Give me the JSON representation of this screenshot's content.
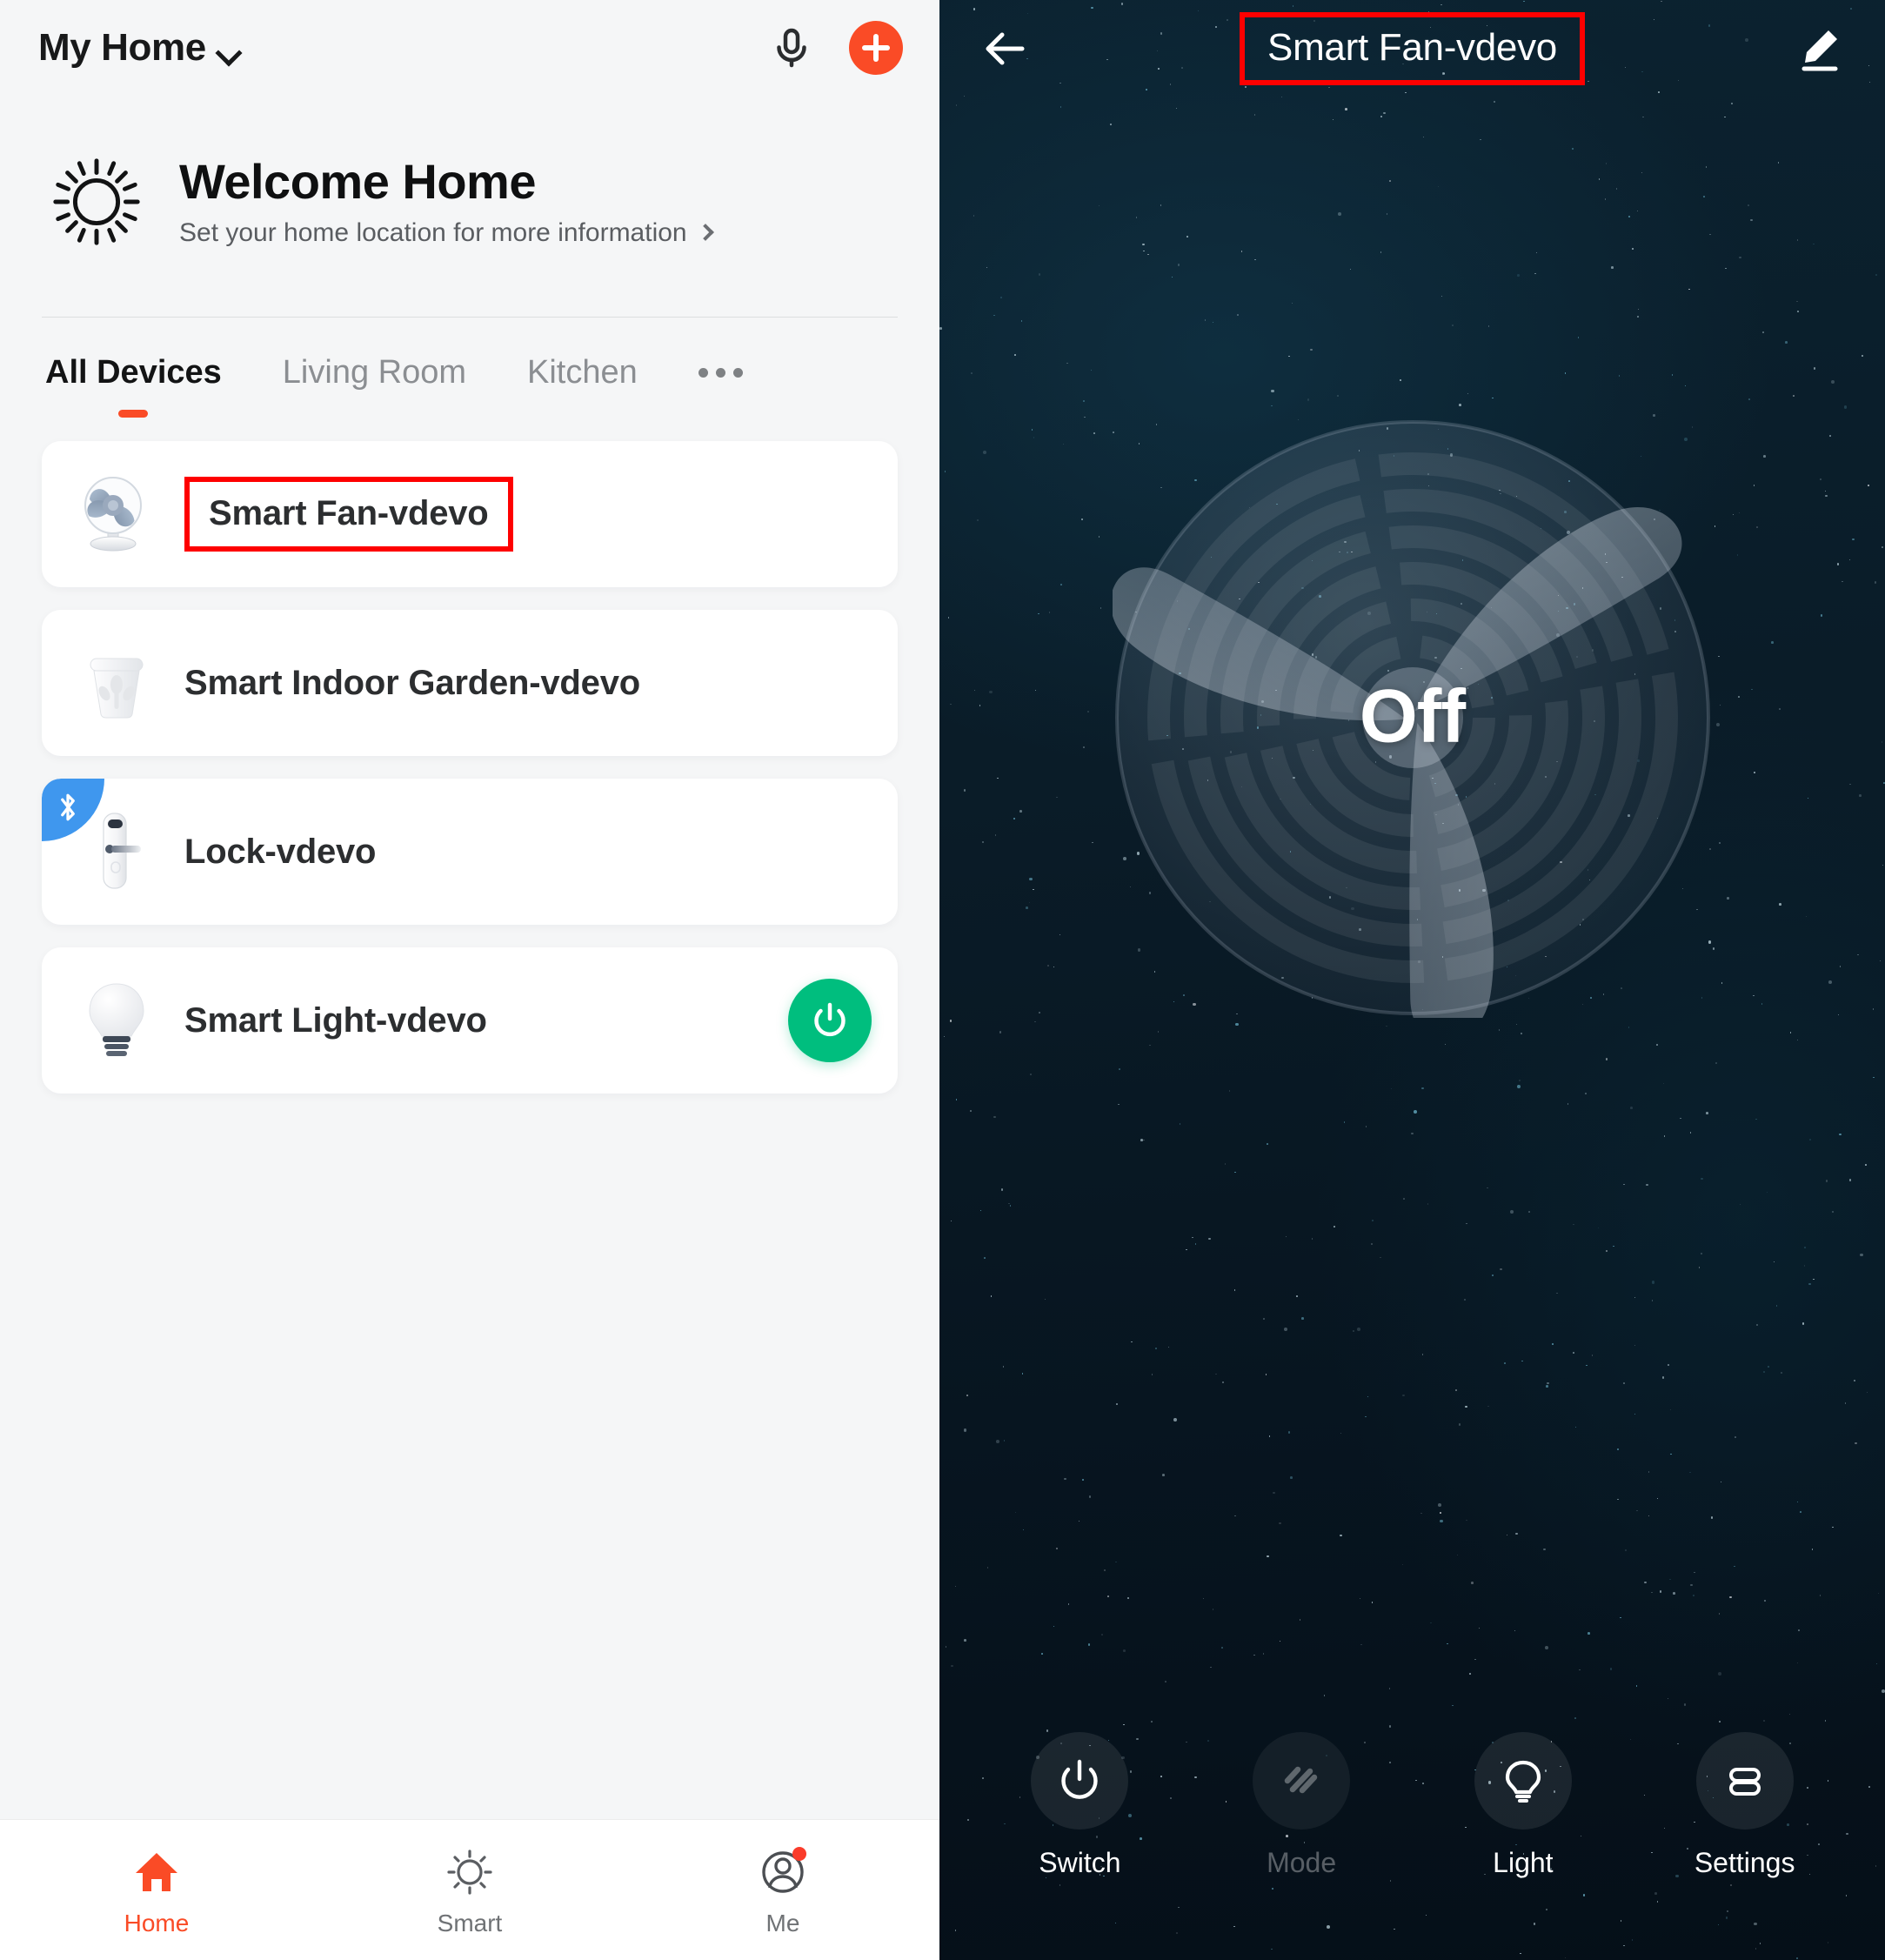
{
  "home": {
    "topbar": {
      "home_name": "My Home",
      "chevron_icon": "chevron-down-icon",
      "mic_icon": "microphone-icon",
      "add_icon": "plus-icon"
    },
    "welcome": {
      "weather_icon": "sun-icon",
      "title": "Welcome Home",
      "subtitle": "Set your home location for more information",
      "chevron_icon": "chevron-right-icon"
    },
    "tabs": [
      {
        "label": "All Devices",
        "active": true
      },
      {
        "label": "Living Room",
        "active": false
      },
      {
        "label": "Kitchen",
        "active": false
      }
    ],
    "tabs_more_icon": "ellipsis-icon",
    "devices": [
      {
        "name": "Smart Fan-vdevo",
        "icon": "desk-fan-icon",
        "highlighted": true,
        "has_power_toggle": false,
        "bluetooth_badge": false
      },
      {
        "name": "Smart Indoor Garden-vdevo",
        "icon": "plant-pot-icon",
        "highlighted": false,
        "has_power_toggle": false,
        "bluetooth_badge": false
      },
      {
        "name": "Lock-vdevo",
        "icon": "door-lock-icon",
        "highlighted": false,
        "has_power_toggle": false,
        "bluetooth_badge": true
      },
      {
        "name": "Smart Light-vdevo",
        "icon": "light-bulb-icon",
        "highlighted": false,
        "has_power_toggle": true,
        "bluetooth_badge": false
      }
    ],
    "bottom_nav": [
      {
        "label": "Home",
        "icon": "house-icon",
        "active": true,
        "badge": false
      },
      {
        "label": "Smart",
        "icon": "sun-small-icon",
        "active": false,
        "badge": false
      },
      {
        "label": "Me",
        "icon": "user-avatar-icon",
        "active": false,
        "badge": true
      }
    ]
  },
  "device_detail": {
    "back_icon": "arrow-left-icon",
    "title": "Smart Fan-vdevo",
    "edit_icon": "pencil-edit-icon",
    "fan": {
      "state_label": "Off",
      "dial_icon": "fan-dial-icon"
    },
    "toolbar": [
      {
        "label": "Switch",
        "icon": "power-icon",
        "disabled": false
      },
      {
        "label": "Mode",
        "icon": "mode-lines-icon",
        "disabled": true
      },
      {
        "label": "Light",
        "icon": "bulb-outline-icon",
        "disabled": false
      },
      {
        "label": "Settings",
        "icon": "settings-sliders-icon",
        "disabled": false
      }
    ]
  },
  "colors": {
    "accent_orange": "#fa4b26",
    "toggle_green": "#00be7e",
    "bluetooth_blue": "#3f97ee",
    "highlight_red": "#fe0000",
    "list_bg": "#f5f6f7",
    "card_bg": "#ffffff",
    "detail_bg": "#0a1c28"
  }
}
